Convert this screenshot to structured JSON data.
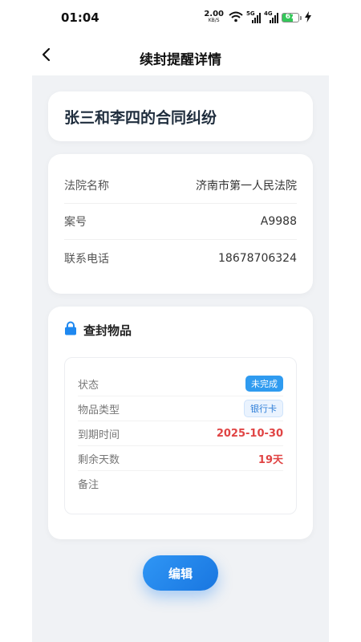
{
  "status_bar": {
    "time": "01:04",
    "net_speed": "2.00",
    "net_unit": "KB/S",
    "sig1_tag": "5G",
    "sig2_tag": "4G",
    "battery": "67",
    "battery_level": 0.67
  },
  "nav": {
    "title": "续封提醒详情"
  },
  "case": {
    "title": "张三和李四的合同纠纷"
  },
  "info": {
    "rows": [
      {
        "label": "法院名称",
        "value": "济南市第一人民法院"
      },
      {
        "label": "案号",
        "value": "A9988"
      },
      {
        "label": "联系电话",
        "value": "18678706324"
      }
    ]
  },
  "seal": {
    "title": "查封物品",
    "status_label": "状态",
    "status_value": "未完成",
    "type_label": "物品类型",
    "type_value": "银行卡",
    "due_label": "到期时间",
    "due_value": "2025-10-30",
    "remain_label": "剩余天数",
    "remain_value": "19天",
    "note_label": "备注",
    "note_value": ""
  },
  "actions": {
    "edit_label": "编辑"
  },
  "colors": {
    "accent": "#1e88f0",
    "danger": "#e04444",
    "background": "#f0f2f5"
  }
}
